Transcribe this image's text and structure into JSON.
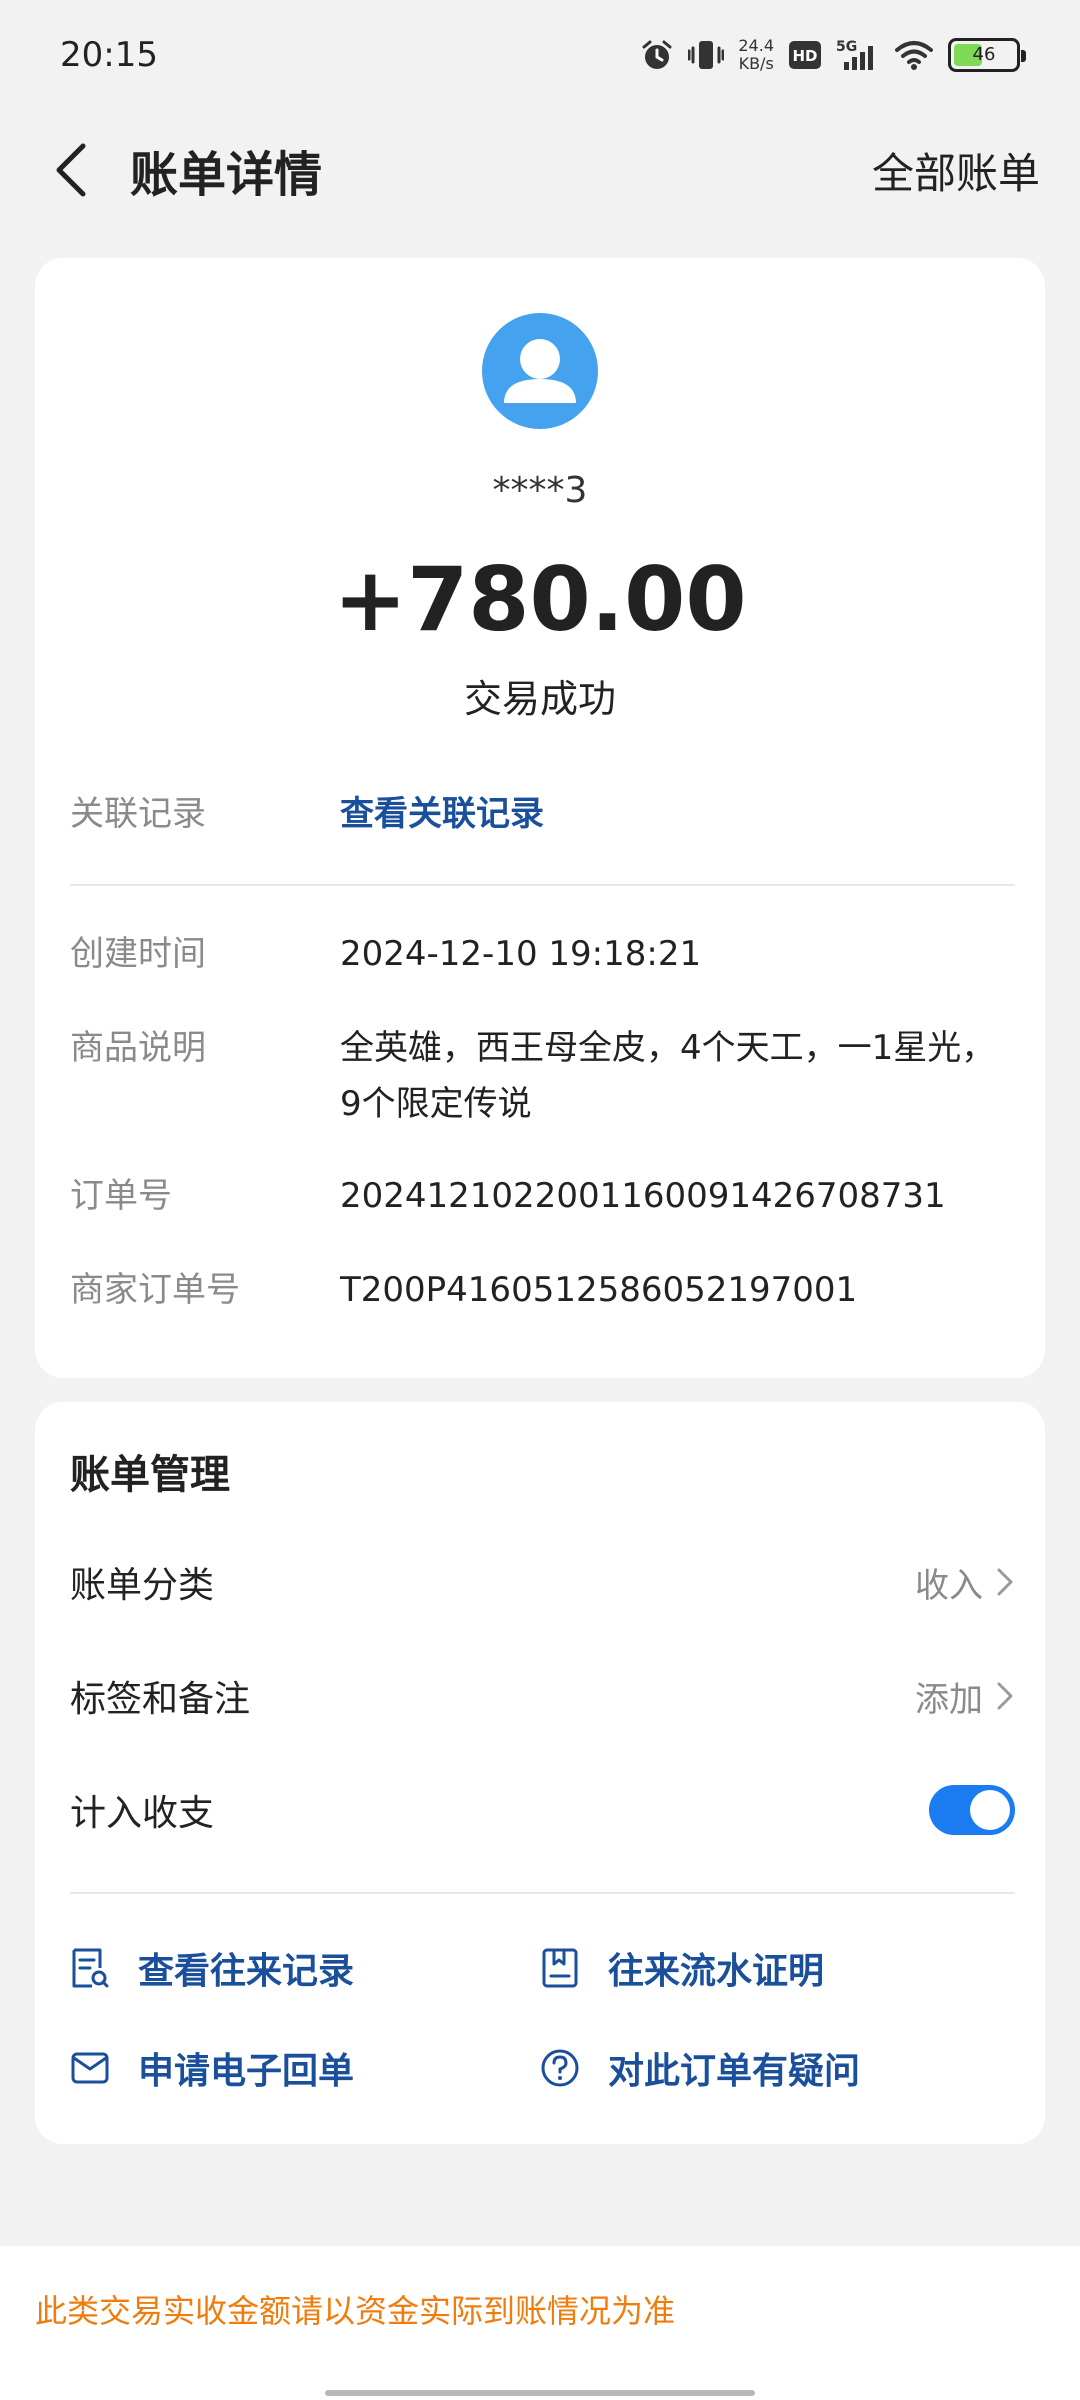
{
  "status_bar": {
    "time": "20:15",
    "net_speed_value": "24.4",
    "net_speed_unit": "KB/s",
    "hd_badge": "HD",
    "network": "5G",
    "battery": "46",
    "icons": [
      "alarm-icon",
      "vibrate-icon",
      "hd-icon",
      "signal-icon",
      "wifi-icon",
      "battery-icon"
    ]
  },
  "header": {
    "title": "账单详情",
    "right_link": "全部账单"
  },
  "summary": {
    "counterparty": "****3",
    "amount": "+780.00",
    "status": "交易成功"
  },
  "details": {
    "related_label": "关联记录",
    "related_value": "查看关联记录",
    "created_label": "创建时间",
    "created_value": "2024-12-10 19:18:21",
    "goods_label": "商品说明",
    "goods_value": "全英雄，西王母全皮，4个天工，一1星光，9个限定传说",
    "order_label": "订单号",
    "order_value": "2024121022001160091426708731",
    "merchant_order_label": "商家订单号",
    "merchant_order_value": "T200P4160512586052197001"
  },
  "management": {
    "title": "账单管理",
    "category_label": "账单分类",
    "category_value": "收入",
    "tags_label": "标签和备注",
    "tags_value": "添加",
    "include_label": "计入收支",
    "include_on": true
  },
  "actions": {
    "history": "查看往来记录",
    "statement": "往来流水证明",
    "receipt": "申请电子回单",
    "question": "对此订单有疑问"
  },
  "footer": {
    "notice": "此类交易实收金额请以资金实际到账情况为准"
  },
  "colors": {
    "link": "#1a4f9c",
    "toggle": "#1a7cf0",
    "avatar": "#45a2ef",
    "notice": "#ee7d0e",
    "battery_fill": "#7fd957"
  }
}
